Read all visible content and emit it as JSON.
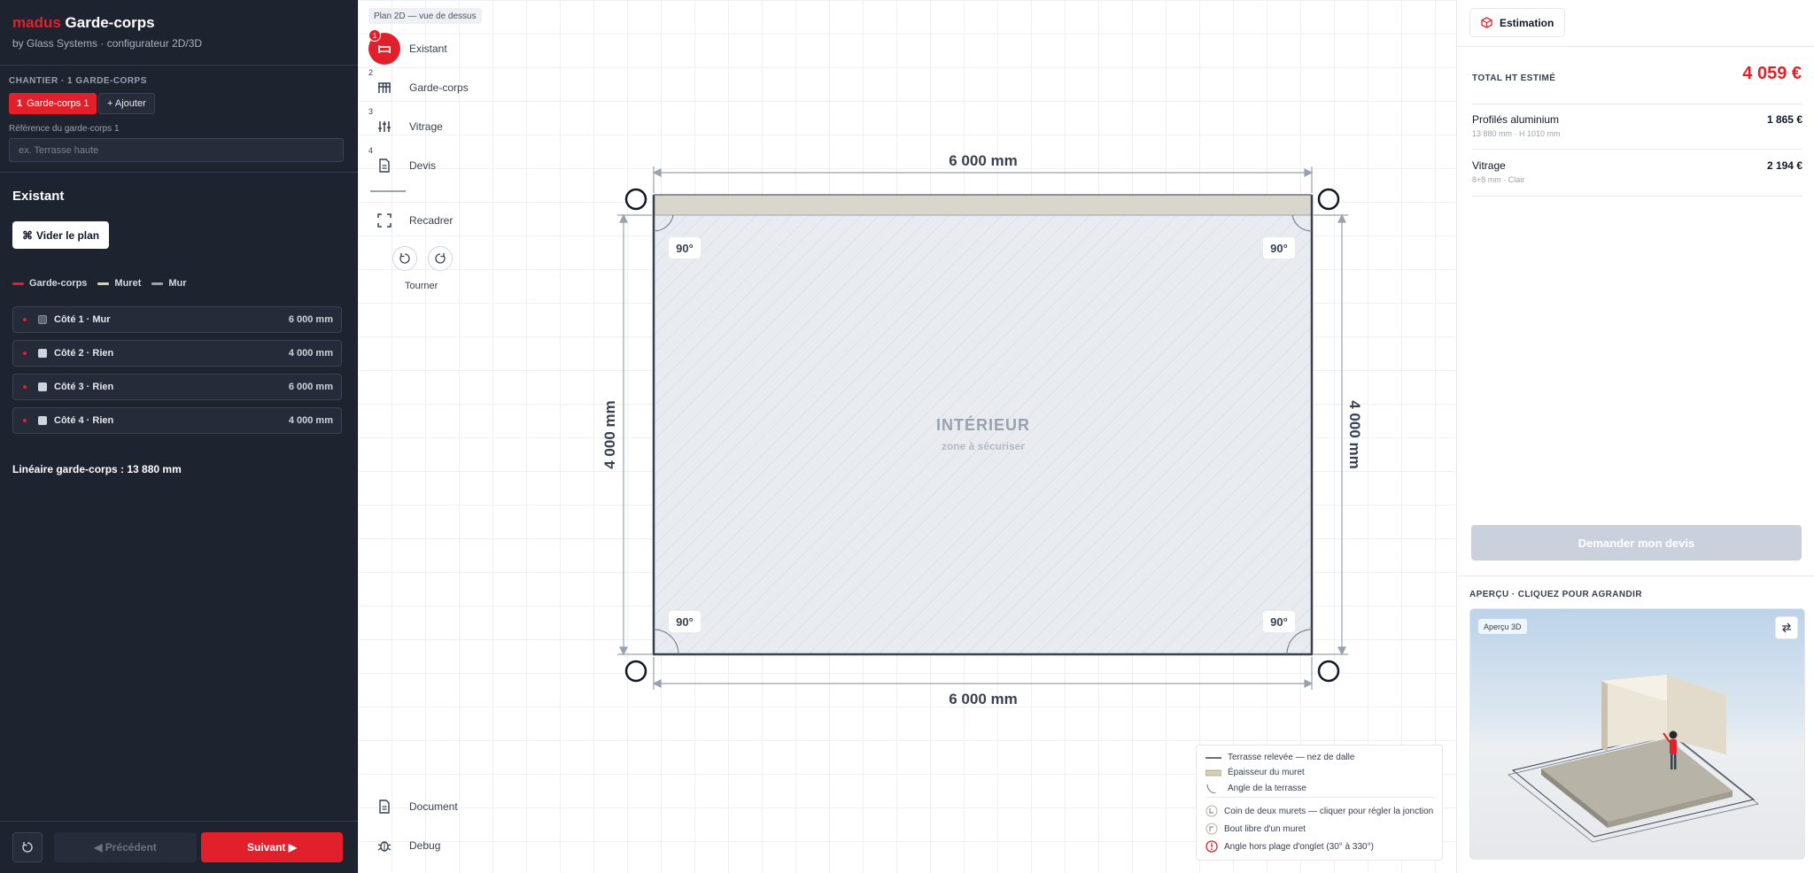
{
  "brand": {
    "red_part": "madus",
    "title": "Garde-corps",
    "subtitle": "by Glass Systems · configurateur 2D/3D"
  },
  "chantier": {
    "label": "CHANTIER · 1 GARDE-CORPS",
    "active_chip": {
      "num": "1",
      "label": "Garde-corps 1"
    },
    "add_label": "+ Ajouter",
    "ref_label": "Référence du garde-corps 1",
    "ref_placeholder": "ex. Terrasse haute",
    "ref_value": ""
  },
  "existant": {
    "title": "Existant",
    "clear_label": "Vider le plan",
    "legend": [
      {
        "label": "Garde-corps",
        "color": "#e2202b"
      },
      {
        "label": "Muret",
        "color": "#d9cfa9"
      },
      {
        "label": "Mur",
        "color": "#9aa1ae"
      }
    ],
    "sides": [
      {
        "name": "Côté 1 · Mur",
        "length": "6 000 mm",
        "box_color": "#5b6270"
      },
      {
        "name": "Côté 2 · Rien",
        "length": "4 000 mm",
        "box_color": "#d1d5db"
      },
      {
        "name": "Côté 3 · Rien",
        "length": "6 000 mm",
        "box_color": "#d1d5db"
      },
      {
        "name": "Côté 4 · Rien",
        "length": "4 000 mm",
        "box_color": "#d1d5db"
      }
    ],
    "lineaire": "Linéaire garde-corps : 13 880 mm"
  },
  "footer_nav": {
    "prev_label": "◀ Précédent",
    "next_label": "Suivant ▶"
  },
  "canvas": {
    "view_tag": "Plan 2D — vue de dessus",
    "steps": [
      {
        "num": "1",
        "label": "Existant",
        "icon": "existant-icon",
        "active": true
      },
      {
        "num": "2",
        "label": "Garde-corps",
        "icon": "railing-icon",
        "active": false
      },
      {
        "num": "3",
        "label": "Vitrage",
        "icon": "sliders-icon",
        "active": false
      },
      {
        "num": "4",
        "label": "Devis",
        "icon": "document-icon",
        "active": false
      }
    ],
    "recadrer": "Recadrer",
    "tourner": "Tourner",
    "document": "Document",
    "debug": "Debug",
    "plan": {
      "top_dim": "6 000 mm",
      "bottom_dim": "6 000 mm",
      "left_dim": "4 000 mm",
      "right_dim": "4 000 mm",
      "interior_title": "INTÉRIEUR",
      "interior_sub": "zone à sécuriser",
      "angles": [
        "90°",
        "90°",
        "90°",
        "90°"
      ]
    },
    "legend": {
      "items": [
        "Terrasse relevée — nez de dalle",
        "Épaisseur du muret",
        "Angle de la terrasse",
        "Coin de deux murets — cliquer pour régler la jonction",
        "Bout libre d'un muret",
        "Angle hors plage d'onglet (30° à 330°)"
      ]
    }
  },
  "estimation": {
    "tab_label": "Estimation",
    "total_label": "TOTAL HT ESTIMÉ",
    "total_value": "4 059 €",
    "items": [
      {
        "name": "Profilés aluminium",
        "sub": "13 880 mm · H 1010 mm",
        "price": "1 865 €"
      },
      {
        "name": "Vitrage",
        "sub": "8+8 mm · Clair",
        "price": "2 194 €"
      }
    ],
    "devis_button": "Demander mon devis",
    "apercu_label": "APERÇU · CLIQUEZ POUR AGRANDIR",
    "apercu_badge": "Aperçu 3D"
  },
  "colors": {
    "accent": "#e2202b",
    "sidebar_bg": "#1e2330",
    "muret": "#d9d6cc",
    "interior": "#e8ecf0"
  }
}
